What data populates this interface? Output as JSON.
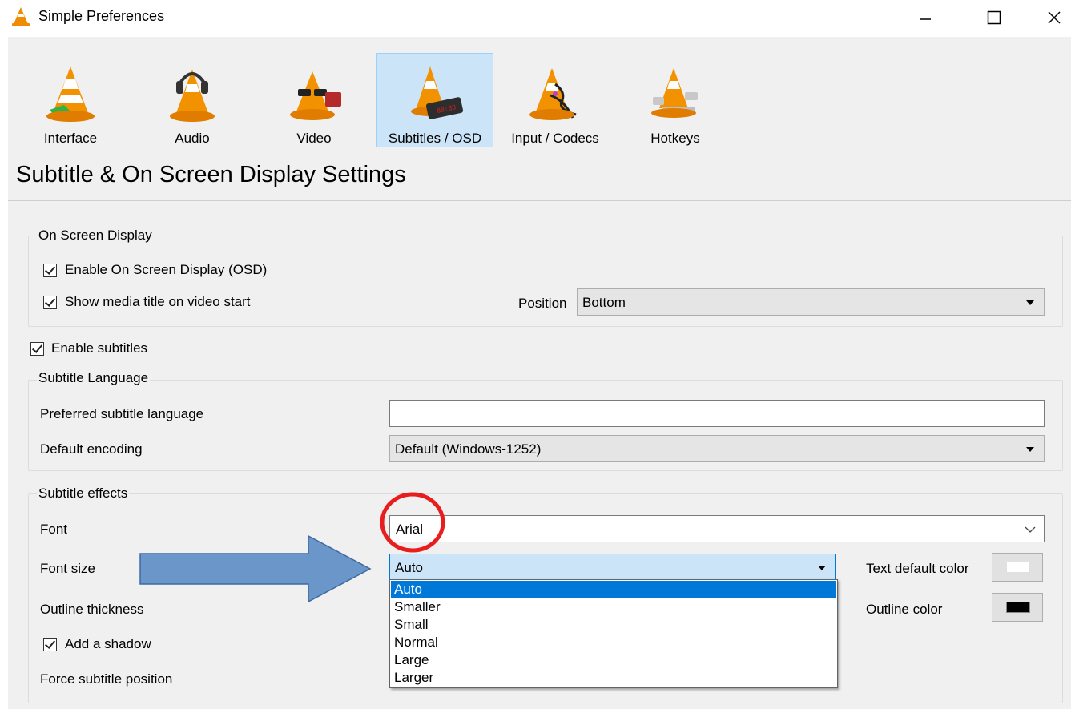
{
  "window": {
    "title": "Simple Preferences",
    "icon": "vlc-cone-icon",
    "controls": [
      "minimize",
      "maximize",
      "close"
    ]
  },
  "toolbar": {
    "items": [
      {
        "label": "Interface",
        "icon": "interface-cone-icon",
        "selected": false
      },
      {
        "label": "Audio",
        "icon": "audio-cone-headphones-icon",
        "selected": false
      },
      {
        "label": "Video",
        "icon": "video-cone-glasses-icon",
        "selected": false
      },
      {
        "label": "Subtitles / OSD",
        "icon": "subtitles-cone-display-icon",
        "selected": true
      },
      {
        "label": "Input / Codecs",
        "icon": "codecs-cone-cables-icon",
        "selected": false
      },
      {
        "label": "Hotkeys",
        "icon": "hotkeys-cone-keyboard-icon",
        "selected": false
      }
    ]
  },
  "heading": "Subtitle & On Screen Display Settings",
  "osd": {
    "group_title": "On Screen Display",
    "enable_osd_label": "Enable On Screen Display (OSD)",
    "enable_osd_checked": true,
    "show_title_label": "Show media title on video start",
    "show_title_checked": true,
    "position_label": "Position",
    "position_value": "Bottom"
  },
  "subtitles": {
    "enable_label": "Enable subtitles",
    "enable_checked": true,
    "language_group_title": "Subtitle Language",
    "preferred_label": "Preferred subtitle language",
    "preferred_value": "",
    "encoding_label": "Default encoding",
    "encoding_value": "Default (Windows-1252)"
  },
  "effects": {
    "group_title": "Subtitle effects",
    "font_label": "Font",
    "font_value": "Arial",
    "font_size_label": "Font size",
    "font_size_value": "Auto",
    "font_size_options": [
      "Auto",
      "Smaller",
      "Small",
      "Normal",
      "Large",
      "Larger"
    ],
    "font_size_highlighted": "Auto",
    "outline_thickness_label": "Outline thickness",
    "shadow_label": "Add a shadow",
    "shadow_checked": true,
    "force_position_label": "Force subtitle position",
    "text_color_label": "Text default color",
    "text_color": "#ffffff",
    "outline_color_label": "Outline color",
    "outline_color": "#000000"
  },
  "annotations": {
    "circle_color": "#e81e1e",
    "arrow_color": "#6b96c9"
  }
}
